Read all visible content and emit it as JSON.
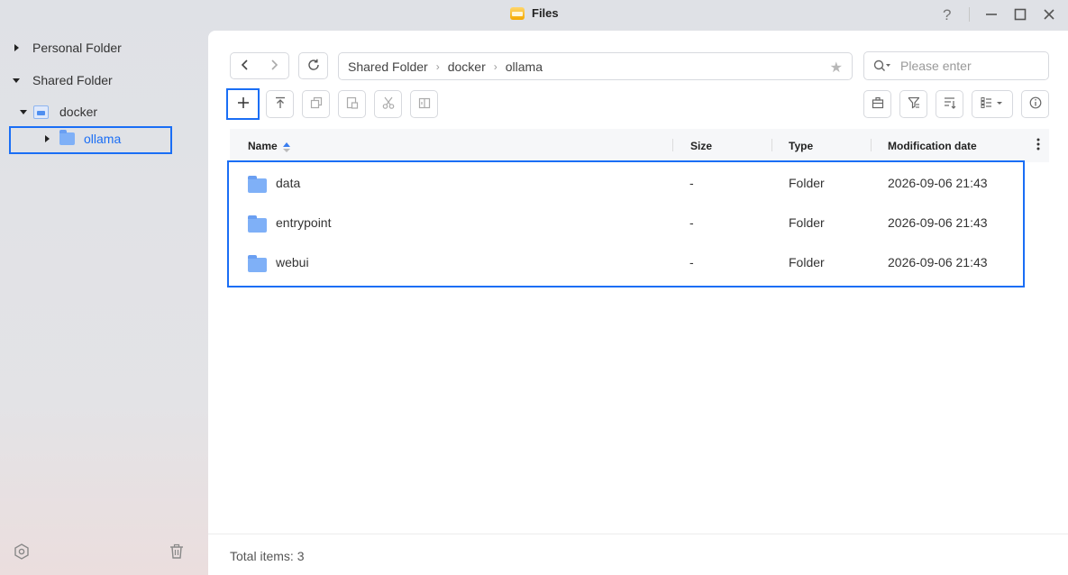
{
  "window": {
    "title": "Files",
    "help_icon": "help-icon",
    "minimize_icon": "minimize-icon",
    "maximize_icon": "maximize-icon",
    "close_icon": "close-icon"
  },
  "sidebar": {
    "items": [
      {
        "label": "Personal Folder",
        "expanded": false
      },
      {
        "label": "Shared Folder",
        "expanded": true
      },
      {
        "label": "docker",
        "expanded": true,
        "icon": "docker-icon"
      },
      {
        "label": "ollama",
        "expanded": false,
        "icon": "folder-icon",
        "selected": true
      }
    ],
    "bottom": {
      "settings_icon": "settings-icon",
      "trash_icon": "trash-icon"
    }
  },
  "toolbar": {
    "back_icon": "chevron-left-icon",
    "forward_icon": "chevron-right-icon",
    "refresh_icon": "refresh-icon",
    "breadcrumb": [
      "Shared Folder",
      "docker",
      "ollama"
    ],
    "favorite_icon": "star-icon",
    "search_placeholder": "Please enter",
    "actions": [
      {
        "name": "add-icon",
        "enabled": true
      },
      {
        "name": "upload-icon",
        "enabled": true
      },
      {
        "name": "copy-icon",
        "enabled": false
      },
      {
        "name": "paste-icon",
        "enabled": false
      },
      {
        "name": "cut-icon",
        "enabled": false
      },
      {
        "name": "move-icon",
        "enabled": false
      }
    ],
    "right_actions": [
      "briefcase-icon",
      "filter-icon",
      "sort-icon",
      "view-list-icon",
      "info-icon"
    ]
  },
  "table": {
    "columns": [
      "Name",
      "Size",
      "Type",
      "Modification date"
    ],
    "sort_column": "Name",
    "rows": [
      {
        "name": "data",
        "size": "-",
        "type": "Folder",
        "date": "2026-09-06 21:43"
      },
      {
        "name": "entrypoint",
        "size": "-",
        "type": "Folder",
        "date": "2026-09-06 21:43"
      },
      {
        "name": "webui",
        "size": "-",
        "type": "Folder",
        "date": "2026-09-06 21:43"
      }
    ]
  },
  "footer": {
    "total_label": "Total items: 3"
  },
  "colors": {
    "accent": "#1a6ef5",
    "folder": "#7fb0f7",
    "ollama_text": "#1a6ef5"
  }
}
